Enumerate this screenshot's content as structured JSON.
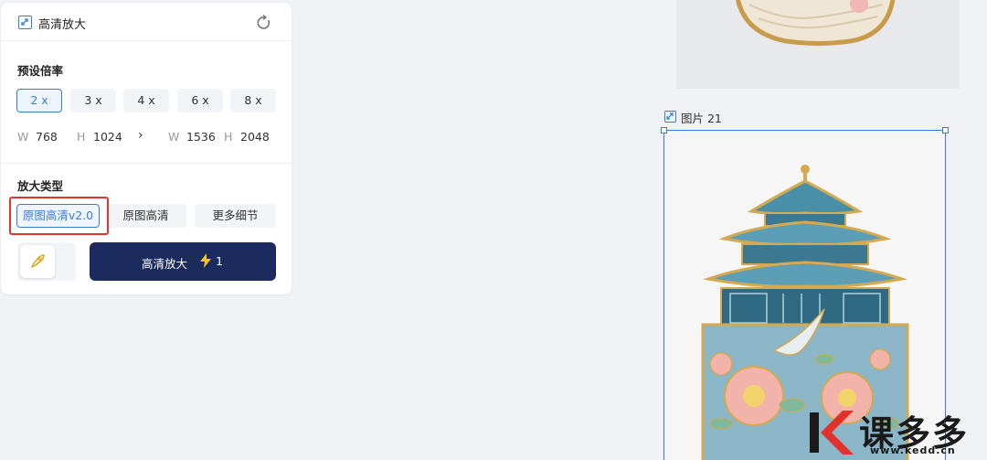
{
  "panel": {
    "title": "高清放大",
    "preset_label": "预设倍率",
    "scales": [
      "2 x",
      "3 x",
      "4 x",
      "6 x",
      "8 x"
    ],
    "selected_scale": "2 x",
    "dims": {
      "w_key": "W",
      "src_w": "768",
      "h_key": "H",
      "src_h": "1024",
      "dst_w": "1536",
      "dst_h": "2048"
    },
    "type_label": "放大类型",
    "types": [
      "原图高清v2.0",
      "原图高清",
      "更多细节"
    ],
    "selected_type": "原图高清v2.0",
    "action_label": "高清放大",
    "action_cost": "1"
  },
  "canvas": {
    "frame_label": "图片 21"
  },
  "watermark": {
    "brand": "课多多",
    "url": "www.kedd.cn"
  },
  "colors": {
    "accent": "#3a7bd5",
    "primary_button": "#1c2b5e",
    "highlight_box": "#e0362b",
    "bolt": "#f5c518"
  }
}
